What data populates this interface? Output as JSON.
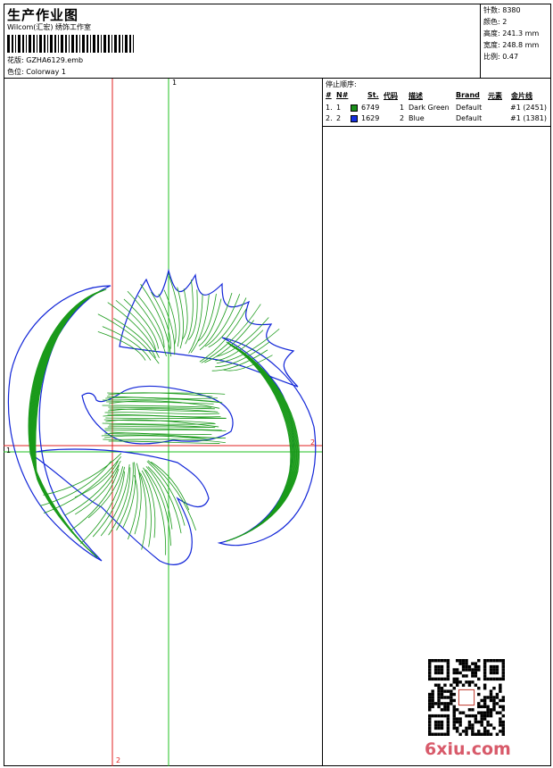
{
  "header": {
    "title": "生产作业图",
    "subtitle": "Wilcom(汇宏) 绣饰工作室",
    "design_label": "花版:",
    "design_value": "GZHA6129.emb",
    "colorway_label": "色位:",
    "colorway_value": "Colorway 1"
  },
  "stats": {
    "stitches": "针数: 8380",
    "colors": "颜色: 2",
    "height": "高度: 241.3 mm",
    "width": "宽度: 248.8 mm",
    "scale": "比例: 0.47"
  },
  "guides": {
    "v_green_top": "1",
    "h_green_left": "1",
    "h_red_right": "2",
    "v_red_bottom": "2"
  },
  "stop_sequence": {
    "title": "停止顺序:",
    "headers": {
      "index": "#",
      "number": "N#",
      "stitches": "St.",
      "code": "代码",
      "description": "描述",
      "brand": "Brand",
      "element": "元素",
      "sequin": "金片线"
    },
    "rows": [
      {
        "index": "1.",
        "number": "1",
        "color": "#1a8f1a",
        "stitches": "6749",
        "code": "1",
        "description": "Dark Green",
        "brand": "Default",
        "sequin": "#1 (2451)"
      },
      {
        "index": "2.",
        "number": "2",
        "color": "#1530e0",
        "stitches": "1629",
        "code": "2",
        "description": "Blue",
        "brand": "Default",
        "sequin": "#1 (1381)"
      }
    ]
  },
  "watermark": "6xiu.com",
  "colors": {
    "stitch_green": "#1a9a1a",
    "stitch_blue": "#1226d8",
    "guide_red": "#e02020",
    "guide_green": "#20c020",
    "watermark": "#d85a6a"
  }
}
